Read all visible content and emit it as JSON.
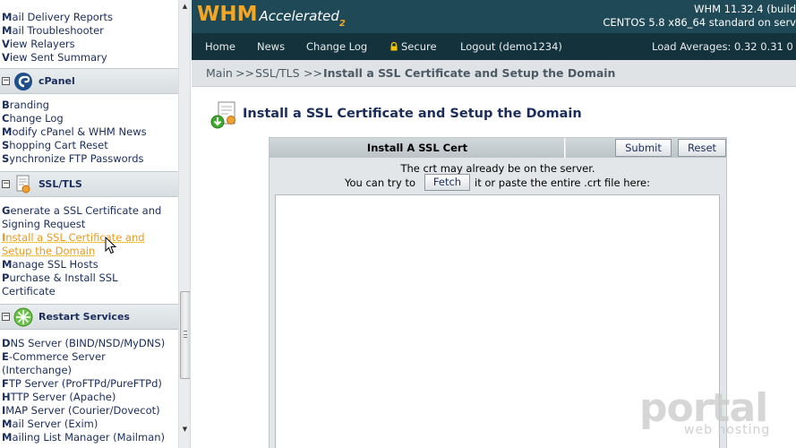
{
  "sidebar": {
    "links_top": [
      {
        "first": "M",
        "rest": "ail Delivery Reports"
      },
      {
        "first": "M",
        "rest": "ail Troubleshooter"
      },
      {
        "first": "V",
        "rest": "iew Relayers"
      },
      {
        "first": "V",
        "rest": "iew Sent Summary"
      }
    ],
    "sections": [
      {
        "title": "cPanel",
        "icon": "cpanel-icon",
        "links": [
          {
            "first": "B",
            "rest": "randing"
          },
          {
            "first": "C",
            "rest": "hange Log"
          },
          {
            "first": "M",
            "rest": "odify cPanel & WHM News"
          },
          {
            "first": "S",
            "rest": "hopping Cart Reset"
          },
          {
            "first": "S",
            "rest": "ynchronize FTP Passwords"
          }
        ]
      },
      {
        "title": "SSL/TLS",
        "icon": "certificate-icon",
        "links": [
          {
            "first": "G",
            "rest": "enerate a SSL Certificate and"
          },
          {
            "first": "",
            "rest": "Signing Request"
          },
          {
            "first": "I",
            "rest": "nstall a SSL Certificate and"
          },
          {
            "first": "",
            "rest": "Setup the Domain"
          },
          {
            "first": "M",
            "rest": "anage SSL Hosts"
          },
          {
            "first": "P",
            "rest": "urchase & Install SSL"
          },
          {
            "first": "",
            "rest": "Certificate"
          }
        ]
      },
      {
        "title": "Restart Services",
        "icon": "restart-services-icon",
        "links": [
          {
            "first": "D",
            "rest": "NS Server (BIND/NSD/MyDNS)"
          },
          {
            "first": "E",
            "rest": "-Commerce Server"
          },
          {
            "first": "",
            "rest": "(Interchange)"
          },
          {
            "first": "F",
            "rest": "TP Server (ProFTPd/PureFTPd)"
          },
          {
            "first": "H",
            "rest": "TTP Server (Apache)"
          },
          {
            "first": "I",
            "rest": "MAP Server (Courier/Dovecot)"
          },
          {
            "first": "M",
            "rest": "ail Server (Exim)"
          },
          {
            "first": "M",
            "rest": "ailing List Manager (Mailman)"
          }
        ]
      }
    ],
    "toggle_symbol": "−"
  },
  "header": {
    "logo_main": "WHM",
    "logo_accent": "Accelerated",
    "logo_sub": "2",
    "version_line1": "WHM 11.32.4 (build",
    "version_line2": "CENTOS 5.8 x86_64 standard on serv"
  },
  "nav": {
    "items": [
      "Home",
      "News",
      "Change Log",
      "Secure",
      "Logout (demo1234)"
    ],
    "load_averages": "Load Averages: 0.32 0.31 0"
  },
  "breadcrumb": {
    "main": "Main",
    "sep": ">>",
    "section": "SSL/TLS",
    "current": "Install a SSL Certificate and Setup the Domain"
  },
  "main": {
    "title": "Install a SSL Certificate and Setup the Domain",
    "form": {
      "heading": "Install A SSL Cert",
      "submit_label": "Submit",
      "reset_label": "Reset",
      "message1": "The crt may already be on the server.",
      "message2": "You can try to",
      "fetch_label": "Fetch",
      "message3": "it or paste the entire .crt file here:",
      "crt_value": ""
    }
  },
  "watermark": {
    "brand": "portal",
    "tagline": "web hosting"
  },
  "colors": {
    "header_bg": "#1f4956",
    "nav_bg": "#14323c",
    "logo_orange": "#f5a623",
    "link_blue": "#1b2d5c",
    "active_link": "#e89a1e"
  }
}
